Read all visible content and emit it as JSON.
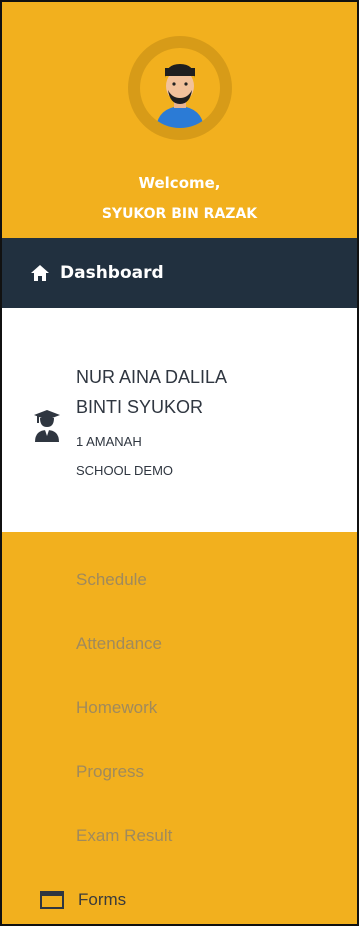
{
  "profile": {
    "welcome": "Welcome,",
    "username": "SYUKOR BIN RAZAK",
    "avatar_icon": "user-avatar-icon"
  },
  "nav": {
    "dashboard": {
      "label": "Dashboard",
      "icon": "home-icon"
    }
  },
  "student": {
    "icon": "graduate-student-icon",
    "name": "NUR AINA DALILA BINTI SYUKOR",
    "class": "1 AMANAH",
    "school": "SCHOOL DEMO"
  },
  "menu": {
    "items": [
      {
        "label": "Schedule"
      },
      {
        "label": "Attendance"
      },
      {
        "label": "Homework"
      },
      {
        "label": "Progress"
      },
      {
        "label": "Exam Result"
      }
    ],
    "forms": {
      "label": "Forms",
      "icon": "window-icon"
    }
  },
  "colors": {
    "sidebar_bg": "#f2b01e",
    "dashboard_bg": "#21303f",
    "card_bg": "#ffffff",
    "muted_text": "#a08a5c"
  }
}
